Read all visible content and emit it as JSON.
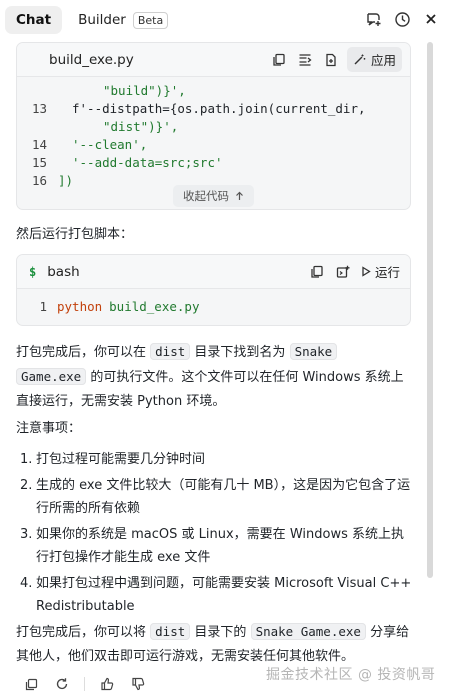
{
  "tabs": {
    "chat": "Chat",
    "builder": "Builder",
    "beta_badge": "Beta",
    "icons": [
      "new-chat-icon",
      "history-icon",
      "close-icon"
    ]
  },
  "code_block_1": {
    "filename": "build_exe.py",
    "apply_label": "应用",
    "collapse_label": "收起代码",
    "lines": [
      {
        "num": "",
        "text": "\"build\")}',"
      },
      {
        "num": "13",
        "text": "f'--distpath={os.path.join(current_dir,"
      },
      {
        "num": "",
        "text": "\"dist\")}',"
      },
      {
        "num": "14",
        "text": "'--clean',"
      },
      {
        "num": "15",
        "text": "'--add-data=src;src'"
      },
      {
        "num": "16",
        "text": "])"
      }
    ]
  },
  "para_run": "然后运行打包脚本：",
  "code_block_2": {
    "language": "bash",
    "prompt": "$",
    "run_label": "运行",
    "line_num": "1",
    "line_cmd": "python",
    "line_arg": "build_exe.py"
  },
  "para_done": {
    "t1": "打包完成后，你可以在",
    "c1": "dist",
    "t2": "目录下找到名为",
    "c2": "Snake",
    "c3": "Game.exe",
    "t3": "的可执行文件。这个文件可以在任何 Windows 系统上直接运行，无需安装 Python 环境。"
  },
  "notes_heading": "注意事项：",
  "notes": [
    {
      "n": "1.",
      "text": "打包过程可能需要几分钟时间"
    },
    {
      "n": "2.",
      "text": "生成的 exe 文件比较大（可能有几十 MB），这是因为它包含了运行所需的所有依赖"
    },
    {
      "n": "3.",
      "text": "如果你的系统是 macOS 或 Linux，需要在 Windows 系统上执行打包操作才能生成 exe 文件"
    },
    {
      "n": "4.",
      "text": "如果打包过程中遇到问题，可能需要安装 Microsoft Visual C++ Redistributable"
    }
  ],
  "para_share": {
    "t1": "打包完成后，你可以将",
    "c1": "dist",
    "t2": "目录下的",
    "c2": "Snake Game.exe",
    "t3": "分享给其他人，他们双击即可运行游戏，无需安装任何其他软件。"
  },
  "watermark": "掘金技术社区 @ 投资帆哥"
}
